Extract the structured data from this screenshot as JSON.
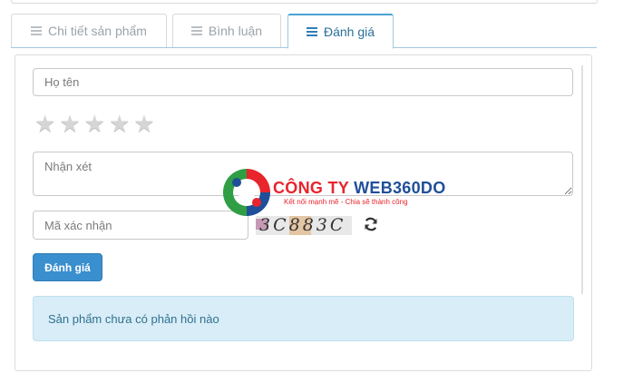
{
  "tabs": [
    {
      "label": "Chi tiết sản phẩm",
      "icon": "menu-icon",
      "active": false
    },
    {
      "label": "Bình luận",
      "icon": "menu-icon",
      "active": false
    },
    {
      "label": "Đánh giá",
      "icon": "menu-icon",
      "active": true
    }
  ],
  "form": {
    "name_placeholder": "Họ tên",
    "rating": {
      "value": 0,
      "max": 5
    },
    "comment_placeholder": "Nhận xét",
    "captcha_placeholder": "Mã xác nhận",
    "captcha_text": "3C883C",
    "refresh_icon": "refresh-icon",
    "submit_label": "Đánh giá"
  },
  "alert": {
    "message": "Sản phẩm chưa có phản hồi nào"
  },
  "watermark": {
    "company_prefix": "CÔNG TY",
    "company_name": "WEB360DO",
    "slogan": "Kết nối mạnh mẽ - Chia sẽ thành công"
  },
  "colors": {
    "accent": "#3a8fce",
    "alert_bg": "#d8edf7",
    "alert_text": "#31708f",
    "brand_red": "#e8242c",
    "brand_blue": "#1f4f99"
  }
}
